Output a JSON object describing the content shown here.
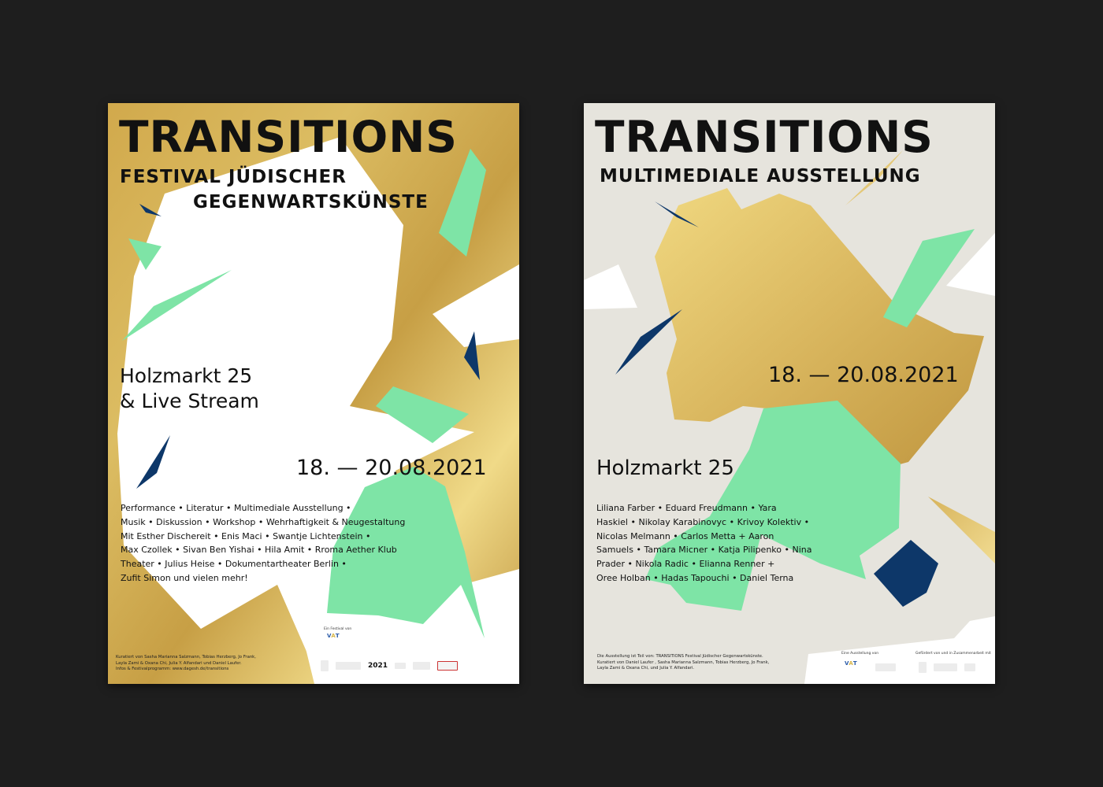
{
  "background_color": "#1e1e1e",
  "colors": {
    "gold_light": "#f0d880",
    "gold": "#d6b257",
    "gold_dark": "#b98f35",
    "mint": "#7ee4a6",
    "navy": "#0d3769",
    "white": "#ffffff",
    "warm_grey": "#e6e4dd"
  },
  "poster_left": {
    "title": "TRANSITIONS",
    "subtitle_line1": "FESTIVAL JÜDISCHER",
    "subtitle_line2": "GEGENWARTSKÜNSTE",
    "venue_line1": "Holzmarkt 25",
    "venue_line2": "& Live Stream",
    "date": "18. — 20.08.2021",
    "program_lines": [
      "Performance • Literatur • Multimediale Ausstellung •",
      "Musik • Diskussion • Workshop • Wehrhaftigkeit & Neugestaltung",
      "Mit Esther Dischereit • Enis Maci • Swantje Lichtenstein •",
      "Max Czollek • Sivan Ben Yishai • Hila Amit • Rroma Aether Klub",
      "Theater • Julius Heise • Dokumentartheater Berlin •",
      "Zufit Simon und vielen mehr!"
    ],
    "footer_lines": [
      "Kuratiert von Sasha Marianna Salzmann, Tobias Herzberg, Jo Frank,",
      "Layla Zami & Oxana Chi, Julia Y. Alfandari und Daniel Laufer.",
      "Infos & Festivalprogramm: www.dagesh.de/transitions"
    ],
    "sponsor_caption": "Ein Festival von",
    "sponsor_year": "2021"
  },
  "poster_right": {
    "title": "TRANSITIONS",
    "subtitle": "MULTIMEDIALE AUSSTELLUNG",
    "date": "18. — 20.08.2021",
    "venue": "Holzmarkt 25",
    "artist_lines": [
      "Liliana Farber • Eduard Freudmann • Yara",
      "Haskiel • Nikolay Karabinovyc • Krivoy Kolektiv •",
      "Nicolas Melmann • Carlos Metta + Aaron",
      "Samuels • Tamara Micner • Katja Pilipenko • Nina",
      "Prader • Nikola Radic • Elianna Renner +",
      "Oree Holban • Hadas Tapouchi • Daniel Terna"
    ],
    "footer_lines": [
      "Die Ausstellung ist Teil von: TRANSITIONS Festival Jüdischer Gegenwartskünste.",
      "Kuratiert von Daniel Laufer , Sasha Marianna Salzmann, Tobias Herzberg, Jo Frank,",
      "Layla Zami & Oxana Chi, und Julia Y. Alfandari."
    ],
    "sponsor_caption_1": "Eine Ausstellung von",
    "sponsor_caption_2": "Gefördert von und in Zusammenarbeit mit"
  }
}
